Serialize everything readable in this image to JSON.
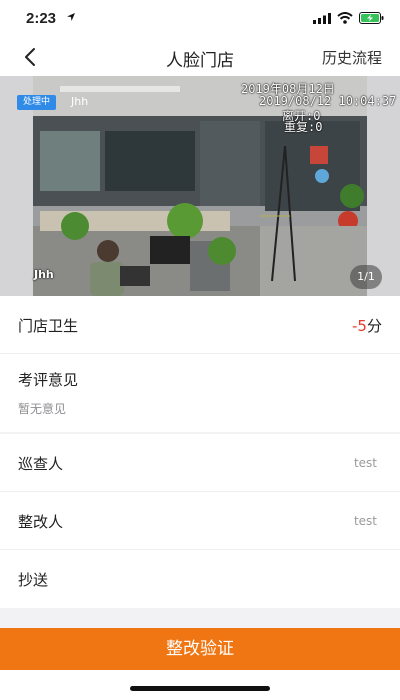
{
  "status_bar": {
    "time": "2:23"
  },
  "nav": {
    "title": "人脸门店",
    "history_label": "历史流程"
  },
  "photo": {
    "badge": "处理中",
    "owner": "Jhh",
    "watermark_date1": "2019年08月12日",
    "watermark_date2": "2019/08/12 10:04:37",
    "watermark_leave": "离开:0",
    "watermark_repeat": "重复:0",
    "watermark_name": "Jhh",
    "page_indicator": "1/1"
  },
  "score_row": {
    "label": "门店卫生",
    "score_value": "-5",
    "score_unit": "分"
  },
  "opinion": {
    "label": "考评意见",
    "placeholder": "暂无意见"
  },
  "people": [
    {
      "label": "巡查人",
      "value": "test"
    },
    {
      "label": "整改人",
      "value": "test"
    },
    {
      "label": "抄送",
      "value": ""
    }
  ],
  "action": {
    "label": "整改验证"
  },
  "colors": {
    "accent": "#f07613",
    "badge": "#2f8ae8",
    "score_red": "#e83a2e"
  }
}
